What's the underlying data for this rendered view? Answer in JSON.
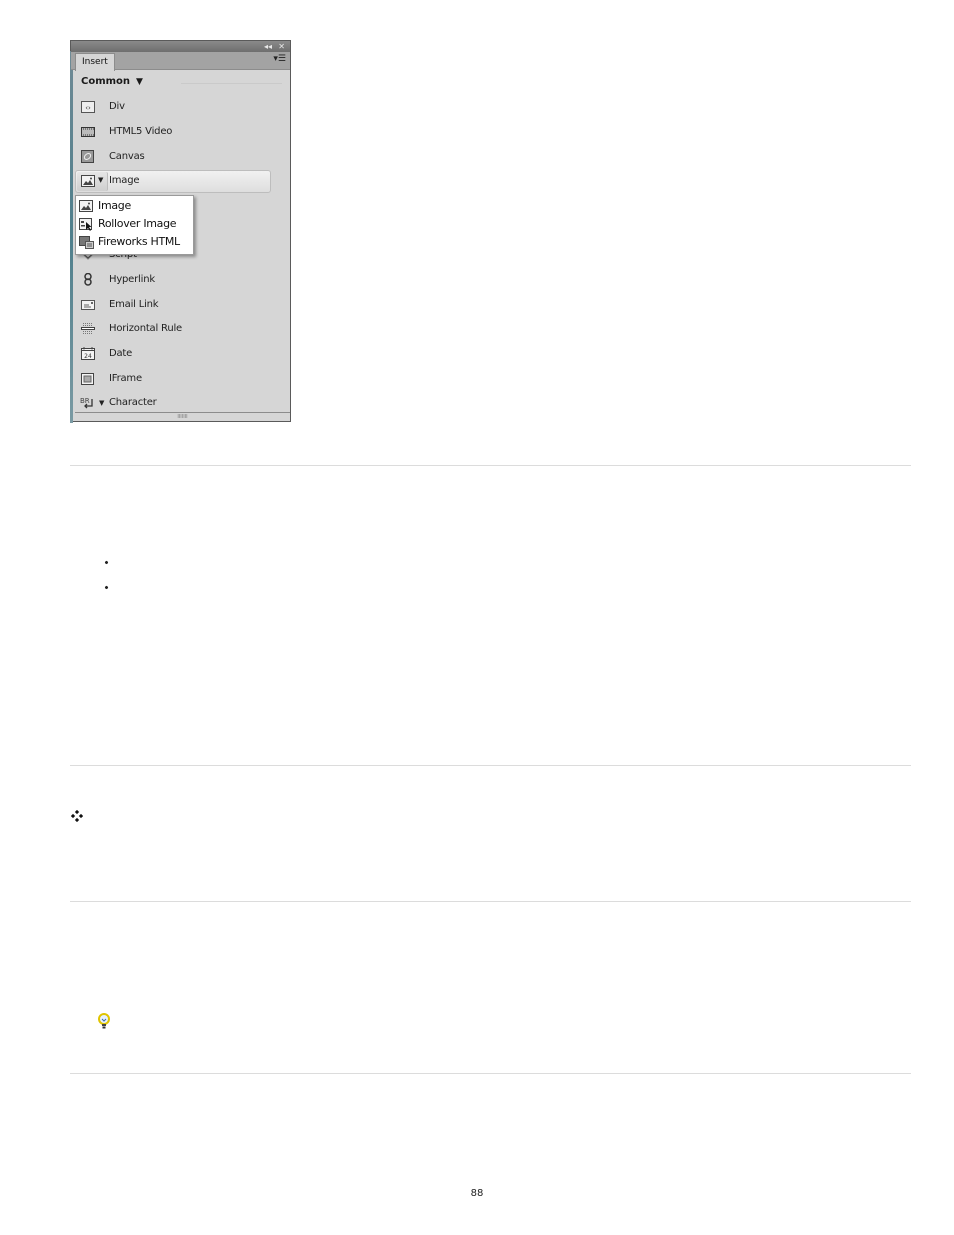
{
  "panel": {
    "tab_label": "Insert",
    "collapse_icon": "double-arrow-left",
    "close_icon": "x",
    "menu_icon": "panel-menu",
    "category": "Common",
    "items": [
      {
        "label": "Div",
        "icon": "div-icon"
      },
      {
        "label": "HTML5 Video",
        "icon": "video-icon"
      },
      {
        "label": "Canvas",
        "icon": "canvas-icon"
      },
      {
        "label": "Image",
        "icon": "image-icon"
      },
      {
        "label": "Script",
        "icon": "script-icon"
      },
      {
        "label": "Hyperlink",
        "icon": "hyperlink-icon"
      },
      {
        "label": "Email Link",
        "icon": "email-icon"
      },
      {
        "label": "Horizontal Rule",
        "icon": "horizontal-rule-icon"
      },
      {
        "label": "Date",
        "icon": "date-icon",
        "glyph": "24"
      },
      {
        "label": "IFrame",
        "icon": "iframe-icon"
      },
      {
        "label": "Character",
        "icon": "character-icon",
        "glyph": "BR"
      }
    ],
    "image_dropdown": [
      {
        "label": "Image",
        "icon": "image-icon"
      },
      {
        "label": "Rollover Image",
        "icon": "rollover-image-icon"
      },
      {
        "label": "Fireworks HTML",
        "icon": "fireworks-html-icon"
      }
    ],
    "resize_grip": "IIIIIII"
  },
  "document": {
    "diamond_glyph": "❖",
    "page_number": "88"
  }
}
